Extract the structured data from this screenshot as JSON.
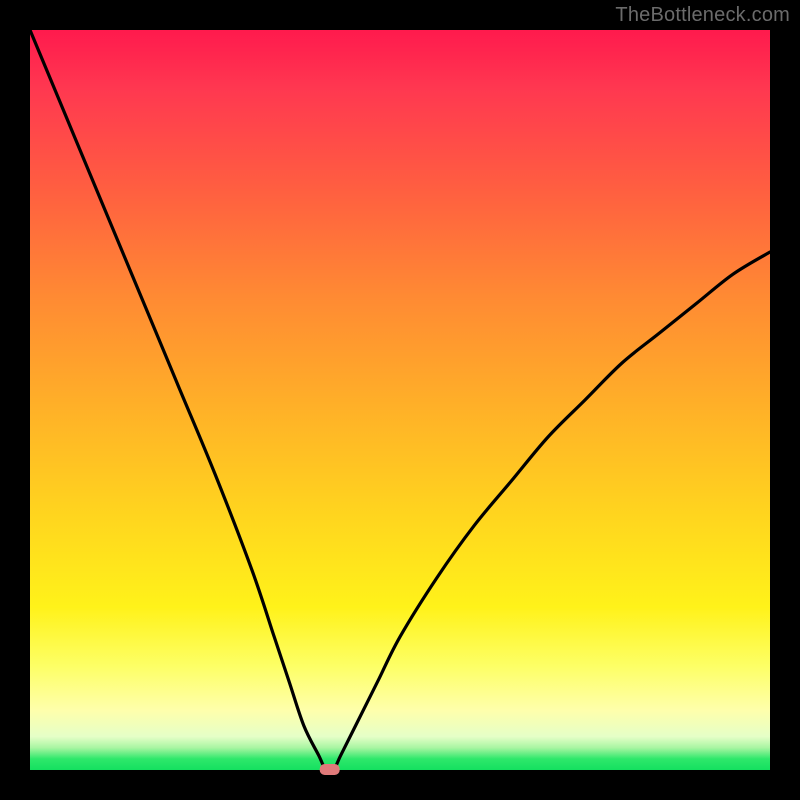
{
  "watermark": "TheBottleneck.com",
  "chart_data": {
    "type": "line",
    "title": "",
    "xlabel": "",
    "ylabel": "",
    "xlim": [
      0,
      100
    ],
    "ylim": [
      0,
      100
    ],
    "grid": false,
    "legend": false,
    "series": [
      {
        "name": "bottleneck-curve",
        "x": [
          0,
          5,
          10,
          15,
          20,
          25,
          30,
          33,
          35,
          37,
          39,
          40,
          41,
          42,
          44,
          47,
          50,
          55,
          60,
          65,
          70,
          75,
          80,
          85,
          90,
          95,
          100
        ],
        "values": [
          100,
          88,
          76,
          64,
          52,
          40,
          27,
          18,
          12,
          6,
          2,
          0,
          0,
          2,
          6,
          12,
          18,
          26,
          33,
          39,
          45,
          50,
          55,
          59,
          63,
          67,
          70
        ]
      }
    ],
    "annotations": [
      {
        "name": "min-marker",
        "x": 40.5,
        "y": 0,
        "color": "#e07a7a"
      }
    ],
    "background_gradient": {
      "orientation": "vertical",
      "stops": [
        {
          "pos": 0.0,
          "color": "#ff1a4d"
        },
        {
          "pos": 0.5,
          "color": "#ffb327"
        },
        {
          "pos": 0.8,
          "color": "#fff21a"
        },
        {
          "pos": 0.95,
          "color": "#feffac"
        },
        {
          "pos": 1.0,
          "color": "#14e060"
        }
      ]
    }
  }
}
